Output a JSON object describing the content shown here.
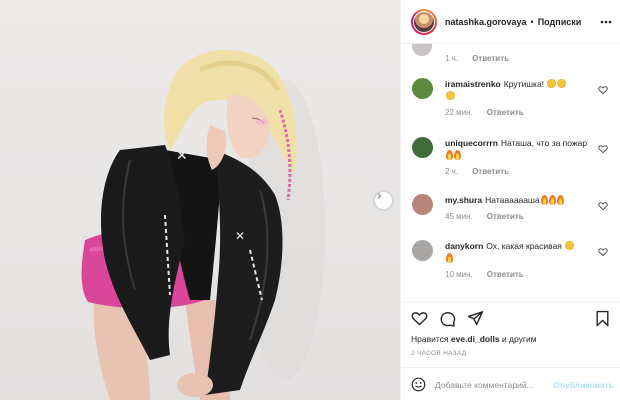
{
  "post": {
    "username": "natashka.gorovaya",
    "separator": "•",
    "follow_label": "Подписки"
  },
  "comments_top": {
    "time": "1 ч.",
    "reply": "Ответить"
  },
  "comments": [
    {
      "user": "iramaistrenko",
      "text": "Крутишка!",
      "emoji": [
        "smile-heart-eyes",
        "smile-heart-eyes",
        "smile-heart-eyes"
      ],
      "time": "22 мин.",
      "reply": "Ответить",
      "avatar_color": "#5d8a3c"
    },
    {
      "user": "uniquecorrrn",
      "text": "Наташа, что за пожар",
      "emoji": [
        "fire",
        "fire"
      ],
      "time": "2 ч.",
      "reply": "Ответить",
      "avatar_color": "#3f6a3a"
    },
    {
      "user": "my.shura",
      "text": "Натааааааша",
      "emoji": [
        "fire",
        "fire",
        "fire"
      ],
      "time": "45 мин.",
      "reply": "Ответить",
      "avatar_color": "#b8857a"
    },
    {
      "user": "danykorn",
      "text": "Ох, какая красивая",
      "emoji": [
        "smile-heart-eyes",
        "fire"
      ],
      "time": "10 мин.",
      "reply": "Ответить",
      "avatar_color": "#a9a6a6"
    }
  ],
  "likes": {
    "prefix": "Нравится",
    "user": "eve.di_dolls",
    "suffix": "и другим"
  },
  "timestamp": "2 ЧАСОВ НАЗАД",
  "add_comment": {
    "placeholder": "Добавьте комментарий...",
    "publish_label": "Опубликовать"
  },
  "icons": {
    "like": "heart-icon",
    "comment": "comment-icon",
    "share": "paper-plane-icon",
    "save": "bookmark-icon",
    "emoji": "emoji-icon",
    "more": "more-dots-icon",
    "next": "chevron-right-icon"
  },
  "colors": {
    "link": "#0095f6",
    "publish_disabled": "#b2dffc",
    "secondary_text": "#8e8e8e",
    "primary_text": "#262626"
  }
}
